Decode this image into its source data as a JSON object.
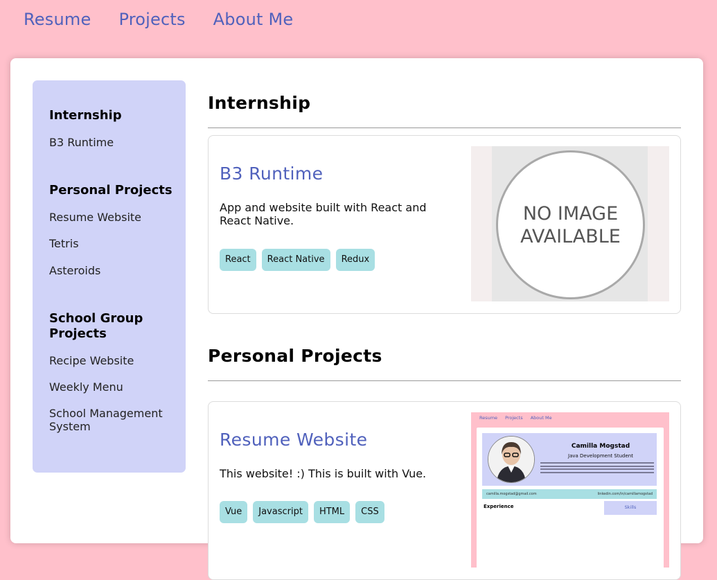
{
  "topnav": {
    "resume": "Resume",
    "projects": "Projects",
    "about": "About Me"
  },
  "sidebar": {
    "groups": [
      {
        "heading": "Internship",
        "items": [
          "B3 Runtime"
        ]
      },
      {
        "heading": "Personal Projects",
        "items": [
          "Resume Website",
          "Tetris",
          "Asteroids"
        ]
      },
      {
        "heading": "School Group Projects",
        "items": [
          "Recipe Website",
          "Weekly Menu",
          "School Management System"
        ]
      }
    ]
  },
  "sections": [
    {
      "title": "Internship",
      "card": {
        "title": "B3 Runtime",
        "description": "App and website built with React and React Native.",
        "tags": [
          "React",
          "React Native",
          "Redux"
        ],
        "image_text": "NO IMAGE AVAILABLE"
      }
    },
    {
      "title": "Personal Projects",
      "card": {
        "title": "Resume Website",
        "description": "This website! :) This is built with Vue.",
        "tags": [
          "Vue",
          "Javascript",
          "HTML",
          "CSS"
        ],
        "preview": {
          "nav": [
            "Resume",
            "Projects",
            "About Me"
          ],
          "name": "Camilla Mogstad",
          "role": "Java Development Student",
          "email": "camilla.mogstad@gmail.com",
          "linkedin": "linkedin.com/in/camillamogstad",
          "experience": "Experience",
          "skills": "Skills"
        }
      }
    }
  ],
  "colors": {
    "page_bg": "#ffc0cb",
    "accent": "#5061bc",
    "sidebar_bg": "#d0d3f8",
    "tag_bg": "#a8dfe3"
  }
}
